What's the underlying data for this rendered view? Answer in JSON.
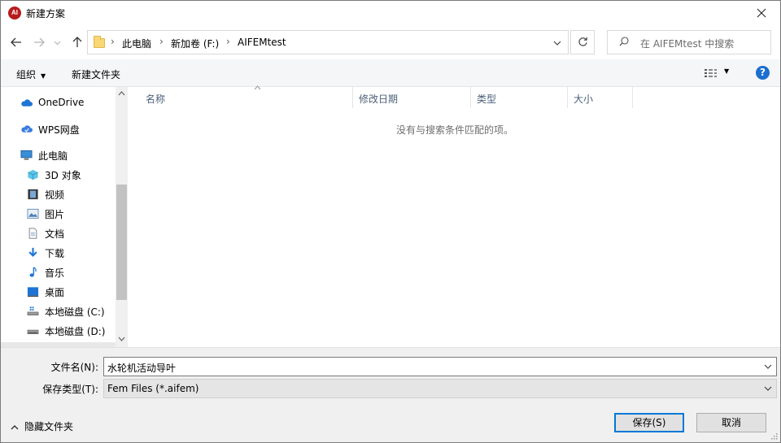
{
  "window": {
    "title": "新建方案",
    "app_icon_text": "AI"
  },
  "nav": {
    "back_icon": "arrow-left-icon",
    "forward_icon": "arrow-right-icon",
    "up_icon": "arrow-up-icon",
    "breadcrumbs": [
      "此电脑",
      "新加卷 (F:)",
      "AIFEMtest"
    ],
    "search_placeholder": "在 AIFEMtest 中搜索"
  },
  "toolbar": {
    "organize_label": "组织",
    "new_folder_label": "新建文件夹"
  },
  "sidebar": {
    "items": [
      {
        "label": "OneDrive",
        "icon": "cloud-icon"
      },
      {
        "label": "WPS网盘",
        "icon": "wps-cloud-icon"
      },
      {
        "label": "此电脑",
        "icon": "computer-icon"
      },
      {
        "label": "3D 对象",
        "icon": "3d-objects-icon"
      },
      {
        "label": "视频",
        "icon": "video-icon"
      },
      {
        "label": "图片",
        "icon": "pictures-icon"
      },
      {
        "label": "文档",
        "icon": "documents-icon"
      },
      {
        "label": "下载",
        "icon": "download-icon"
      },
      {
        "label": "音乐",
        "icon": "music-icon"
      },
      {
        "label": "桌面",
        "icon": "desktop-icon"
      },
      {
        "label": "本地磁盘 (C:)",
        "icon": "drive-c-icon"
      },
      {
        "label": "本地磁盘 (D:)",
        "icon": "drive-d-icon"
      }
    ]
  },
  "filelist": {
    "columns": [
      "名称",
      "修改日期",
      "类型",
      "大小"
    ],
    "empty_message": "没有与搜索条件匹配的项。"
  },
  "form": {
    "filename_label": "文件名(N):",
    "filename_value": "水轮机活动导叶",
    "filetype_label": "保存类型(T):",
    "filetype_value": "Fem Files (*.aifem)",
    "hide_folders_label": "隐藏文件夹",
    "save_label": "保存(S)",
    "cancel_label": "取消"
  },
  "colors": {
    "accent": "#0078d7",
    "help": "#1a6fd1",
    "column_header_text": "#4c607a"
  }
}
